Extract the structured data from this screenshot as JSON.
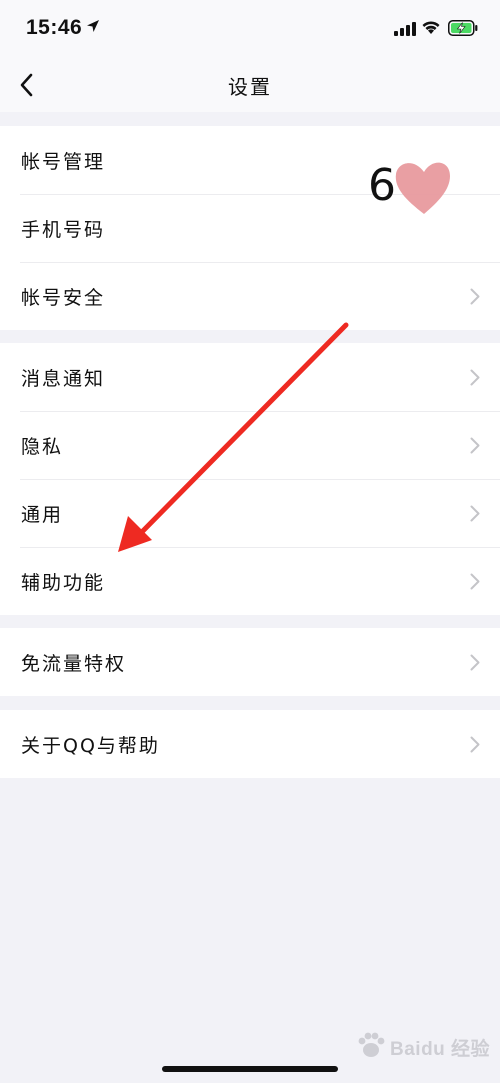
{
  "status_bar": {
    "time": "15:46",
    "icons": [
      "location-arrow-icon",
      "cellular-signal-icon",
      "wifi-icon",
      "battery-charging-icon"
    ],
    "battery_color": "#4cd964"
  },
  "nav": {
    "title": "设置",
    "back_icon": "chevron-left-icon"
  },
  "groups": [
    {
      "items": [
        {
          "label": "帐号管理",
          "chevron": false
        },
        {
          "label": "手机号码",
          "chevron": false
        },
        {
          "label": "帐号安全",
          "chevron": true
        }
      ]
    },
    {
      "items": [
        {
          "label": "消息通知",
          "chevron": true
        },
        {
          "label": "隐私",
          "chevron": true
        },
        {
          "label": "通用",
          "chevron": true
        },
        {
          "label": "辅助功能",
          "chevron": true
        }
      ]
    },
    {
      "items": [
        {
          "label": "免流量特权",
          "chevron": true
        }
      ]
    },
    {
      "items": [
        {
          "label": "关于QQ与帮助",
          "chevron": true
        }
      ]
    }
  ],
  "overlay": {
    "sticker": "6",
    "heart_color": "#e89a9e",
    "arrow_color": "#ee2a22",
    "watermark": "Baidu 经验"
  },
  "colors": {
    "background": "#f2f2f7",
    "cell": "#ffffff",
    "separator": "#ececef",
    "chevron": "#c4c4c8"
  }
}
